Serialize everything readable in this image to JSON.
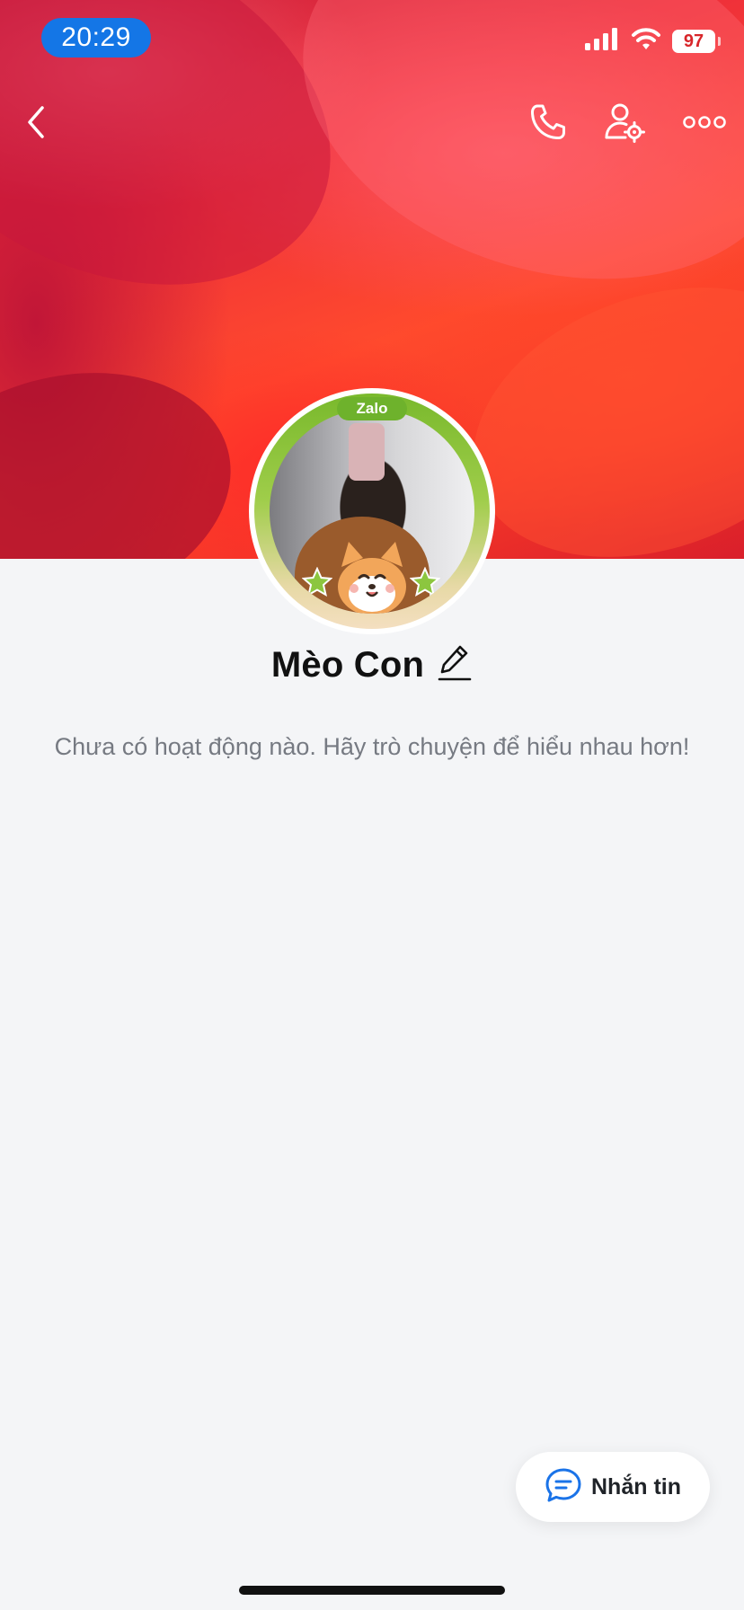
{
  "status_bar": {
    "time": "20:29",
    "battery": "97",
    "signal_icon": "cellular-signal-icon",
    "wifi_icon": "wifi-icon"
  },
  "header": {
    "back_icon": "chevron-left-icon",
    "call_icon": "phone-icon",
    "settings_icon": "user-settings-icon",
    "more_icon": "more-horizontal-icon"
  },
  "profile": {
    "badge": "Zalo",
    "name": "Mèo Con",
    "edit_icon": "pencil-icon",
    "empty_message": "Chưa có hoạt động nào. Hãy trò chuyện để hiểu nhau hơn!"
  },
  "action": {
    "message_label": "Nhắn tin",
    "message_icon": "chat-bubble-icon"
  },
  "colors": {
    "accent": "#1476e6",
    "zalo_green": "#6eb22c",
    "background": "#f4f5f7"
  }
}
